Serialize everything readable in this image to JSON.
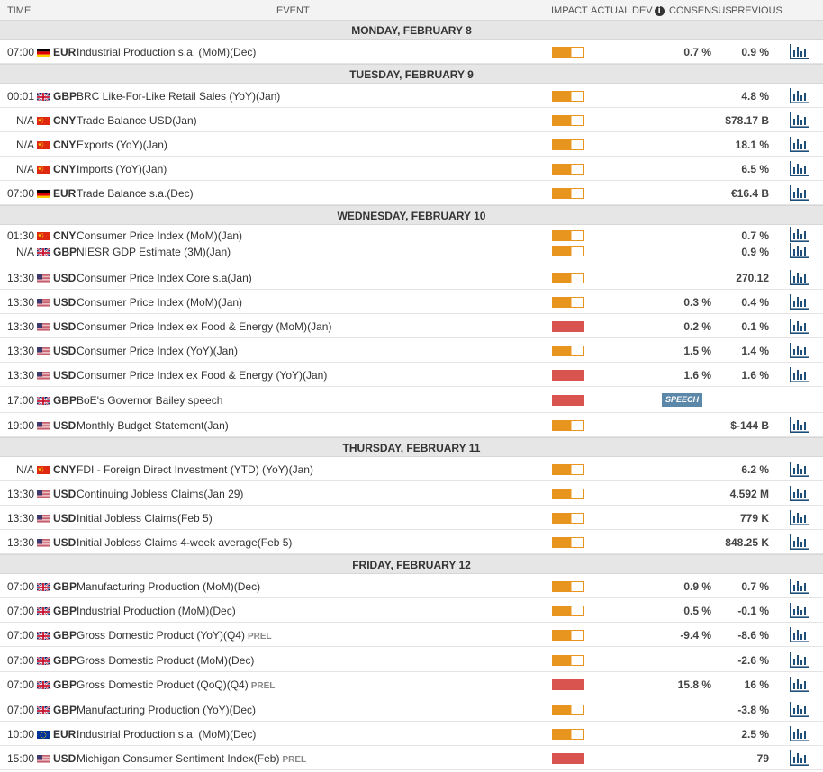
{
  "header": {
    "time": "TIME",
    "event": "EVENT",
    "impact": "IMPACT",
    "actual": "ACTUAL",
    "dev": "DEV",
    "info": "i",
    "consensus": "CONSENSUS",
    "previous": "PREVIOUS"
  },
  "days": [
    {
      "label": "MONDAY, FEBRUARY 8",
      "rows": [
        {
          "time": "07:00",
          "flag": "de",
          "currency": "EUR",
          "event": "Industrial Production s.a. (MoM)(Dec)",
          "impact": "medium",
          "consensus": "0.7 %",
          "previous": "0.9 %",
          "chart": true
        }
      ]
    },
    {
      "label": "TUESDAY, FEBRUARY 9",
      "rows": [
        {
          "time": "00:01",
          "flag": "gb",
          "currency": "GBP",
          "event": "BRC Like-For-Like Retail Sales (YoY)(Jan)",
          "impact": "medium",
          "consensus": "",
          "previous": "4.8 %",
          "chart": true
        },
        {
          "time": "N/A",
          "flag": "cn",
          "currency": "CNY",
          "event": "Trade Balance USD(Jan)",
          "impact": "medium",
          "consensus": "",
          "previous": "$78.17 B",
          "chart": true
        },
        {
          "time": "N/A",
          "flag": "cn",
          "currency": "CNY",
          "event": "Exports (YoY)(Jan)",
          "impact": "medium",
          "consensus": "",
          "previous": "18.1 %",
          "chart": true
        },
        {
          "time": "N/A",
          "flag": "cn",
          "currency": "CNY",
          "event": "Imports (YoY)(Jan)",
          "impact": "medium",
          "consensus": "",
          "previous": "6.5 %",
          "chart": true
        },
        {
          "time": "07:00",
          "flag": "de",
          "currency": "EUR",
          "event": "Trade Balance s.a.(Dec)",
          "impact": "medium",
          "consensus": "",
          "previous": "€16.4 B",
          "chart": true
        }
      ]
    },
    {
      "label": "WEDNESDAY, FEBRUARY 10",
      "rows": [
        {
          "group": true,
          "items": [
            {
              "time": "01:30",
              "flag": "cn",
              "currency": "CNY",
              "event": "Consumer Price Index (MoM)(Jan)",
              "impact": "medium",
              "consensus": "",
              "previous": "0.7 %",
              "chart": true
            },
            {
              "time": "N/A",
              "flag": "gb",
              "currency": "GBP",
              "event": "NIESR GDP Estimate (3M)(Jan)",
              "impact": "medium",
              "consensus": "",
              "previous": "0.9 %",
              "chart": true
            }
          ]
        },
        {
          "time": "13:30",
          "flag": "us",
          "currency": "USD",
          "event": "Consumer Price Index Core s.a(Jan)",
          "impact": "medium",
          "consensus": "",
          "previous": "270.12",
          "chart": true
        },
        {
          "time": "13:30",
          "flag": "us",
          "currency": "USD",
          "event": "Consumer Price Index (MoM)(Jan)",
          "impact": "medium",
          "consensus": "0.3 %",
          "previous": "0.4 %",
          "chart": true
        },
        {
          "time": "13:30",
          "flag": "us",
          "currency": "USD",
          "event": "Consumer Price Index ex Food & Energy (MoM)(Jan)",
          "impact": "high",
          "consensus": "0.2 %",
          "previous": "0.1 %",
          "chart": true
        },
        {
          "time": "13:30",
          "flag": "us",
          "currency": "USD",
          "event": "Consumer Price Index (YoY)(Jan)",
          "impact": "medium",
          "consensus": "1.5 %",
          "previous": "1.4 %",
          "chart": true
        },
        {
          "time": "13:30",
          "flag": "us",
          "currency": "USD",
          "event": "Consumer Price Index ex Food & Energy (YoY)(Jan)",
          "impact": "high",
          "consensus": "1.6 %",
          "previous": "1.6 %",
          "chart": true
        },
        {
          "time": "17:00",
          "flag": "gb",
          "currency": "GBP",
          "event": "BoE's Governor Bailey speech",
          "impact": "high",
          "consensus": "",
          "previous": "",
          "chart": false,
          "badge": "SPEECH"
        },
        {
          "time": "19:00",
          "flag": "us",
          "currency": "USD",
          "event": "Monthly Budget Statement(Jan)",
          "impact": "medium",
          "consensus": "",
          "previous": "$-144 B",
          "chart": true
        }
      ]
    },
    {
      "label": "THURSDAY, FEBRUARY 11",
      "rows": [
        {
          "time": "N/A",
          "flag": "cn",
          "currency": "CNY",
          "event": "FDI - Foreign Direct Investment (YTD) (YoY)(Jan)",
          "impact": "medium",
          "consensus": "",
          "previous": "6.2 %",
          "chart": true
        },
        {
          "time": "13:30",
          "flag": "us",
          "currency": "USD",
          "event": "Continuing Jobless Claims(Jan 29)",
          "impact": "medium",
          "consensus": "",
          "previous": "4.592 M",
          "chart": true
        },
        {
          "time": "13:30",
          "flag": "us",
          "currency": "USD",
          "event": "Initial Jobless Claims(Feb 5)",
          "impact": "medium",
          "consensus": "",
          "previous": "779 K",
          "chart": true
        },
        {
          "time": "13:30",
          "flag": "us",
          "currency": "USD",
          "event": "Initial Jobless Claims 4-week average(Feb 5)",
          "impact": "medium",
          "consensus": "",
          "previous": "848.25 K",
          "chart": true
        }
      ]
    },
    {
      "label": "FRIDAY, FEBRUARY 12",
      "rows": [
        {
          "time": "07:00",
          "flag": "gb",
          "currency": "GBP",
          "event": "Manufacturing Production (MoM)(Dec)",
          "impact": "medium",
          "consensus": "0.9 %",
          "previous": "0.7 %",
          "chart": true
        },
        {
          "time": "07:00",
          "flag": "gb",
          "currency": "GBP",
          "event": "Industrial Production (MoM)(Dec)",
          "impact": "medium",
          "consensus": "0.5 %",
          "previous": "-0.1 %",
          "chart": true
        },
        {
          "time": "07:00",
          "flag": "gb",
          "currency": "GBP",
          "event": "Gross Domestic Product (YoY)(Q4)",
          "prel": "PREL",
          "impact": "medium",
          "consensus": "-9.4 %",
          "previous": "-8.6 %",
          "chart": true
        },
        {
          "time": "07:00",
          "flag": "gb",
          "currency": "GBP",
          "event": "Gross Domestic Product (MoM)(Dec)",
          "impact": "medium",
          "consensus": "",
          "previous": "-2.6 %",
          "chart": true
        },
        {
          "time": "07:00",
          "flag": "gb",
          "currency": "GBP",
          "event": "Gross Domestic Product (QoQ)(Q4)",
          "prel": "PREL",
          "impact": "high",
          "consensus": "15.8 %",
          "previous": "16 %",
          "chart": true
        },
        {
          "time": "07:00",
          "flag": "gb",
          "currency": "GBP",
          "event": "Manufacturing Production (YoY)(Dec)",
          "impact": "medium",
          "consensus": "",
          "previous": "-3.8 %",
          "chart": true
        },
        {
          "time": "10:00",
          "flag": "eu",
          "currency": "EUR",
          "event": "Industrial Production s.a. (MoM)(Dec)",
          "impact": "medium",
          "consensus": "",
          "previous": "2.5 %",
          "chart": true
        },
        {
          "time": "15:00",
          "flag": "us",
          "currency": "USD",
          "event": "Michigan Consumer Sentiment Index(Feb)",
          "prel": "PREL",
          "impact": "high",
          "consensus": "",
          "previous": "79",
          "chart": true
        }
      ]
    }
  ]
}
